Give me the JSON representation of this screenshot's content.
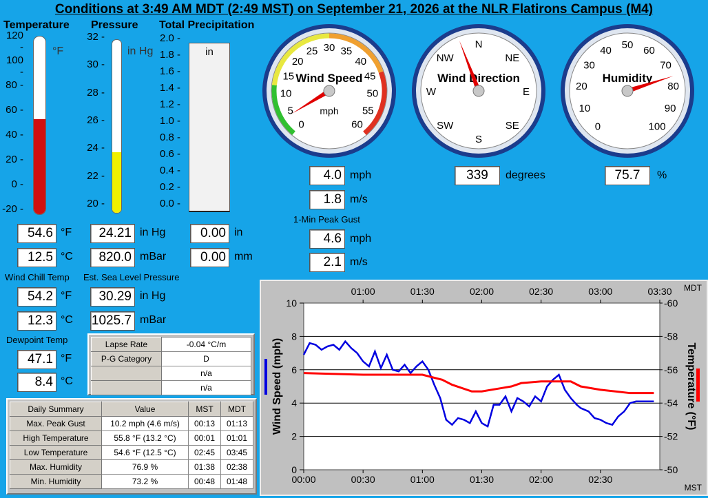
{
  "title": "Conditions at 3:49 AM MDT (2:49 MST) on September 21, 2026 at the NLR Flatirons Campus (M4)",
  "temperature": {
    "header": "Temperature",
    "unit": "°F",
    "ticks": [
      "120",
      "100",
      "80",
      "60",
      "40",
      "20",
      "0",
      "-20"
    ],
    "fill_fraction": 0.535,
    "color": "#d01010",
    "f_value": "54.6",
    "f_unit": "°F",
    "c_value": "12.5",
    "c_unit": "°C"
  },
  "pressure": {
    "header": "Pressure",
    "unit": "in Hg",
    "ticks": [
      "32",
      "30",
      "28",
      "26",
      "24",
      "22",
      "20"
    ],
    "fill_fraction": 0.35,
    "color": "#f0f000",
    "inhg_value": "24.21",
    "inhg_unit": "in Hg",
    "mbar_value": "820.0",
    "mbar_unit": "mBar"
  },
  "precip": {
    "header": "Total Precipitation",
    "unit": "in",
    "ticks": [
      "2.0",
      "1.8",
      "1.6",
      "1.4",
      "1.2",
      "1.0",
      "0.8",
      "0.6",
      "0.4",
      "0.2",
      "0.0"
    ],
    "in_value": "0.00",
    "in_unit": "in",
    "mm_value": "0.00",
    "mm_unit": "mm"
  },
  "wind_chill": {
    "label": "Wind Chill Temp",
    "f_value": "54.2",
    "f_unit": "°F",
    "c_value": "12.3",
    "c_unit": "°C"
  },
  "sea_level": {
    "label": "Est. Sea Level Pressure",
    "inhg_value": "30.29",
    "inhg_unit": "in Hg",
    "mbar_value": "1025.7",
    "mbar_unit": "mBar"
  },
  "dewpoint": {
    "label": "Dewpoint Temp",
    "f_value": "47.1",
    "f_unit": "°F",
    "c_value": "8.4",
    "c_unit": "°C"
  },
  "stability": [
    {
      "label": "Lapse Rate",
      "value": "-0.04 °C/m"
    },
    {
      "label": "P-G Category",
      "value": "D"
    },
    {
      "label": "",
      "value": "n/a"
    },
    {
      "label": "",
      "value": "n/a"
    }
  ],
  "daily_summary": {
    "headers": [
      "Daily Summary",
      "Value",
      "MST",
      "MDT"
    ],
    "rows": [
      [
        "Max. Peak Gust",
        "10.2 mph (4.6 m/s)",
        "00:13",
        "01:13"
      ],
      [
        "High Temperature",
        "55.8 °F (13.2 °C)",
        "00:01",
        "01:01"
      ],
      [
        "Low Temperature",
        "54.6 °F (12.5 °C)",
        "02:45",
        "03:45"
      ],
      [
        "Max. Humidity",
        "76.9 %",
        "01:38",
        "02:38"
      ],
      [
        "Min. Humidity",
        "73.2 %",
        "00:48",
        "01:48"
      ]
    ]
  },
  "wind_speed_gauge": {
    "title": "Wind Speed",
    "unit": "mph",
    "value": 4.0,
    "ticks": [
      "0",
      "5",
      "10",
      "15",
      "20",
      "25",
      "30",
      "35",
      "40",
      "45",
      "50",
      "55",
      "60"
    ],
    "mph_value": "4.0",
    "mph_unit": "mph",
    "ms_value": "1.8",
    "ms_unit": "m/s",
    "gust_label": "1-Min Peak Gust",
    "gust_mph_value": "4.6",
    "gust_mph_unit": "mph",
    "gust_ms_value": "2.1",
    "gust_ms_unit": "m/s"
  },
  "wind_dir_gauge": {
    "title": "Wind Direction",
    "value": 339,
    "ticks": [
      "N",
      "NE",
      "E",
      "SE",
      "S",
      "SW",
      "W",
      "NW"
    ],
    "deg_value": "339",
    "deg_unit": "degrees"
  },
  "humidity_gauge": {
    "title": "Humidity",
    "value": 75.7,
    "ticks": [
      "0",
      "10",
      "20",
      "30",
      "40",
      "50",
      "60",
      "70",
      "80",
      "90",
      "100"
    ],
    "pct_value": "75.7",
    "pct_unit": "%"
  },
  "chart_data": {
    "type": "line",
    "top_axis_label": "MDT",
    "bottom_axis_label": "MST",
    "top_ticks": [
      "01:00",
      "01:30",
      "02:00",
      "02:30",
      "03:00",
      "03:30"
    ],
    "bottom_ticks": [
      "00:00",
      "00:30",
      "01:00",
      "01:30",
      "02:00",
      "02:30"
    ],
    "ylabel_left": "Wind Speed (mph)",
    "ylabel_right": "Temperature (°F)",
    "ylim_left": [
      0,
      10
    ],
    "ylim_right": [
      50,
      60
    ],
    "yticks_left": [
      "10",
      "8",
      "6",
      "4",
      "2",
      "0"
    ],
    "yticks_right": [
      "-60",
      "-58",
      "-56",
      "-54",
      "-52",
      "-50"
    ],
    "grid": true,
    "series": [
      {
        "name": "Wind Speed (mph)",
        "axis": "left",
        "color": "#0000e0",
        "x": [
          0,
          3,
          6,
          9,
          12,
          15,
          18,
          21,
          24,
          27,
          30,
          33,
          36,
          39,
          42,
          45,
          48,
          51,
          54,
          57,
          60,
          63,
          66,
          69,
          72,
          75,
          78,
          81,
          84,
          87,
          90,
          93,
          96,
          99,
          102,
          105,
          108,
          111,
          114,
          117,
          120,
          123,
          126,
          129,
          132,
          135,
          138,
          140,
          144,
          147,
          150,
          153,
          156,
          159,
          162,
          165,
          168,
          171,
          174,
          177
        ],
        "values": [
          6.9,
          7.6,
          7.5,
          7.2,
          7.4,
          7.5,
          7.2,
          7.7,
          7.3,
          7.0,
          6.5,
          6.2,
          7.1,
          6.1,
          6.9,
          6.0,
          5.9,
          6.3,
          5.8,
          6.2,
          6.5,
          6.0,
          5.1,
          4.3,
          3.0,
          2.7,
          3.1,
          3.0,
          2.8,
          3.5,
          2.8,
          2.6,
          3.9,
          3.9,
          4.4,
          3.5,
          4.3,
          4.1,
          3.8,
          4.4,
          4.1,
          5.0,
          5.4,
          5.7,
          4.8,
          4.3,
          3.9,
          3.7,
          3.5,
          3.1,
          3.0,
          2.8,
          2.7,
          3.2,
          3.5,
          4.0,
          4.1,
          4.1,
          4.1,
          4.1
        ]
      },
      {
        "name": "Temperature (°F)",
        "axis": "right",
        "color": "#ff0000",
        "x": [
          0,
          30,
          60,
          70,
          75,
          85,
          90,
          100,
          105,
          110,
          120,
          135,
          140,
          150,
          165,
          177
        ],
        "values": [
          55.8,
          55.7,
          55.7,
          55.4,
          55.1,
          54.7,
          54.7,
          54.9,
          55.0,
          55.2,
          55.3,
          55.3,
          55.0,
          54.8,
          54.6,
          54.6
        ]
      }
    ]
  }
}
